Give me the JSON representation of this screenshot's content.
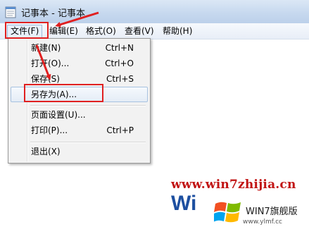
{
  "window": {
    "title": "记事本 - 记事本"
  },
  "menubar": {
    "items": [
      {
        "label": "文件(F)"
      },
      {
        "label": "编辑(E)"
      },
      {
        "label": "格式(O)"
      },
      {
        "label": "查看(V)"
      },
      {
        "label": "帮助(H)"
      }
    ]
  },
  "file_menu": {
    "items": [
      {
        "label": "新建(N)",
        "shortcut": "Ctrl+N"
      },
      {
        "label": "打开(O)...",
        "shortcut": "Ctrl+O"
      },
      {
        "label": "保存(S)",
        "shortcut": "Ctrl+S"
      },
      {
        "label": "另存为(A)...",
        "shortcut": ""
      },
      {
        "label": "页面设置(U)...",
        "shortcut": ""
      },
      {
        "label": "打印(P)...",
        "shortcut": "Ctrl+P"
      },
      {
        "label": "退出(X)",
        "shortcut": ""
      }
    ]
  },
  "watermark": {
    "url": "www.win7zhijia.cn",
    "brand": "WIN7旗舰版",
    "site": "www.ylmf.cc",
    "logo_text": "Wi"
  },
  "colors": {
    "highlight": "#e02020",
    "title_bar": "#c7d9ef",
    "watermark_red": "#c11414"
  }
}
